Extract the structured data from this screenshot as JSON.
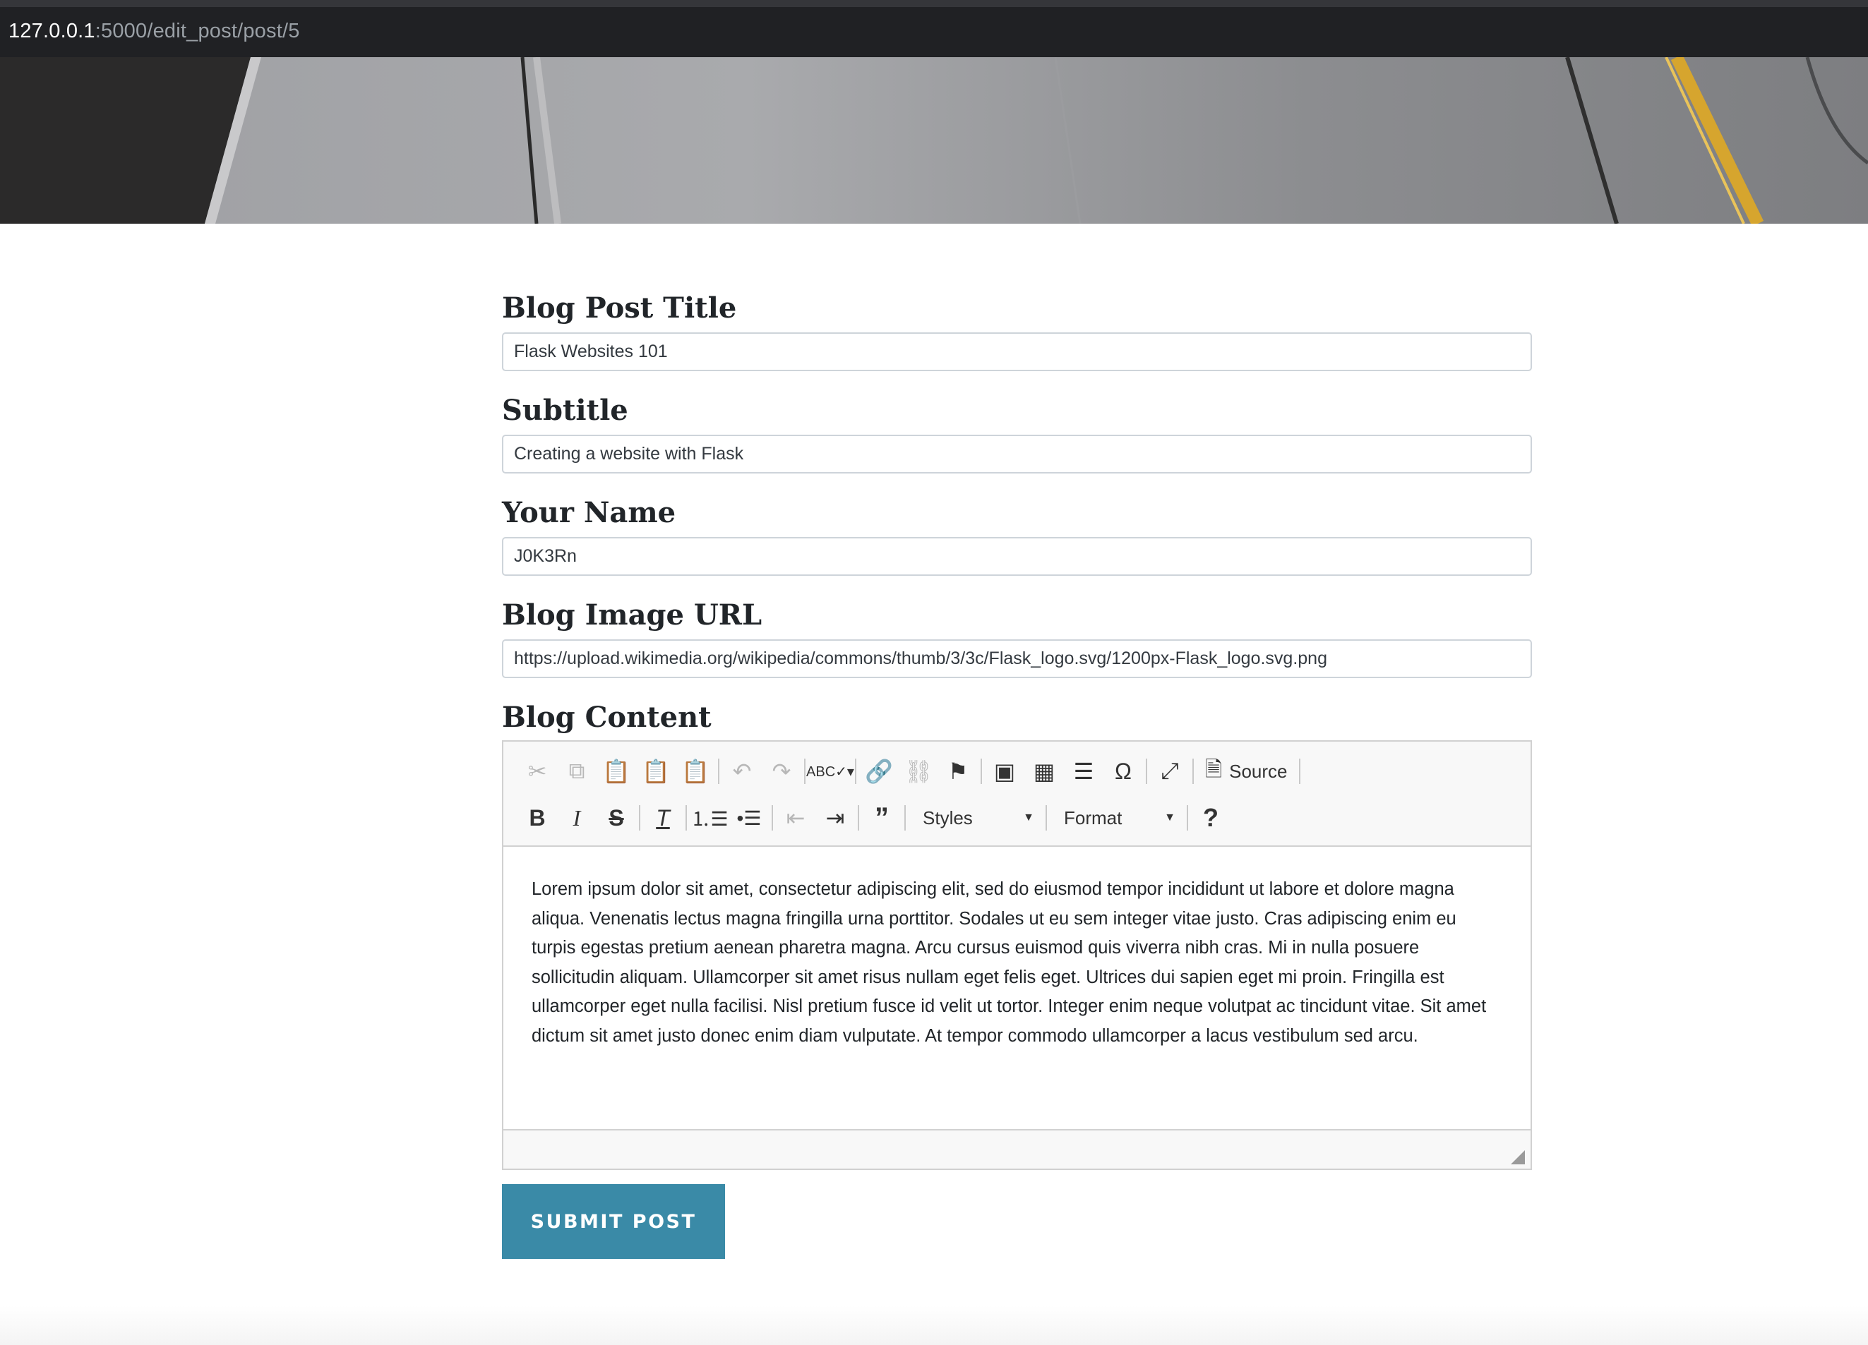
{
  "browser": {
    "url_host": "127.0.0.1",
    "url_path": ":5000/edit_post/post/5"
  },
  "form": {
    "title_label": "Blog Post Title",
    "title_value": "Flask Websites 101",
    "subtitle_label": "Subtitle",
    "subtitle_value": "Creating a website with Flask",
    "name_label": "Your Name",
    "name_value": "J0K3Rn",
    "image_label": "Blog Image URL",
    "image_value": "https://upload.wikimedia.org/wikipedia/commons/thumb/3/3c/Flask_logo.svg/1200px-Flask_logo.svg.png",
    "content_label": "Blog Content",
    "submit_label": "SUBMIT POST"
  },
  "editor": {
    "source_label": "Source",
    "styles_label": "Styles",
    "format_label": "Format",
    "help_label": "?",
    "content": "Lorem ipsum dolor sit amet, consectetur adipiscing elit, sed do eiusmod tempor incididunt ut labore et dolore magna aliqua. Venenatis lectus magna fringilla urna porttitor. Sodales ut eu sem integer vitae justo. Cras adipiscing enim eu turpis egestas pretium aenean pharetra magna. Arcu cursus euismod quis viverra nibh cras. Mi in nulla posuere sollicitudin aliquam. Ullamcorper sit amet risus nullam eget felis eget. Ultrices dui sapien eget mi proin. Fringilla est ullamcorper eget nulla facilisi. Nisl pretium fusce id velit ut tortor. Integer enim neque volutpat ac tincidunt vitae. Sit amet dictum sit amet justo donec enim diam vulputate. At tempor commodo ullamcorper a lacus vestibulum sed arcu.",
    "icons_row1": [
      "cut-icon",
      "copy-icon",
      "paste-icon",
      "paste-text-icon",
      "paste-word-icon",
      "undo-icon",
      "redo-icon",
      "spellcheck-icon",
      "link-icon",
      "unlink-icon",
      "anchor-icon",
      "image-icon",
      "table-icon",
      "horizontal-line-icon",
      "special-char-icon",
      "maximize-icon",
      "source-icon"
    ],
    "icons_row2": [
      "bold-icon",
      "italic-icon",
      "strike-icon",
      "remove-format-icon",
      "numbered-list-icon",
      "bulleted-list-icon",
      "outdent-icon",
      "indent-icon",
      "blockquote-icon"
    ]
  },
  "colors": {
    "accent": "#3a8aa7",
    "address_bar": "#202124"
  }
}
